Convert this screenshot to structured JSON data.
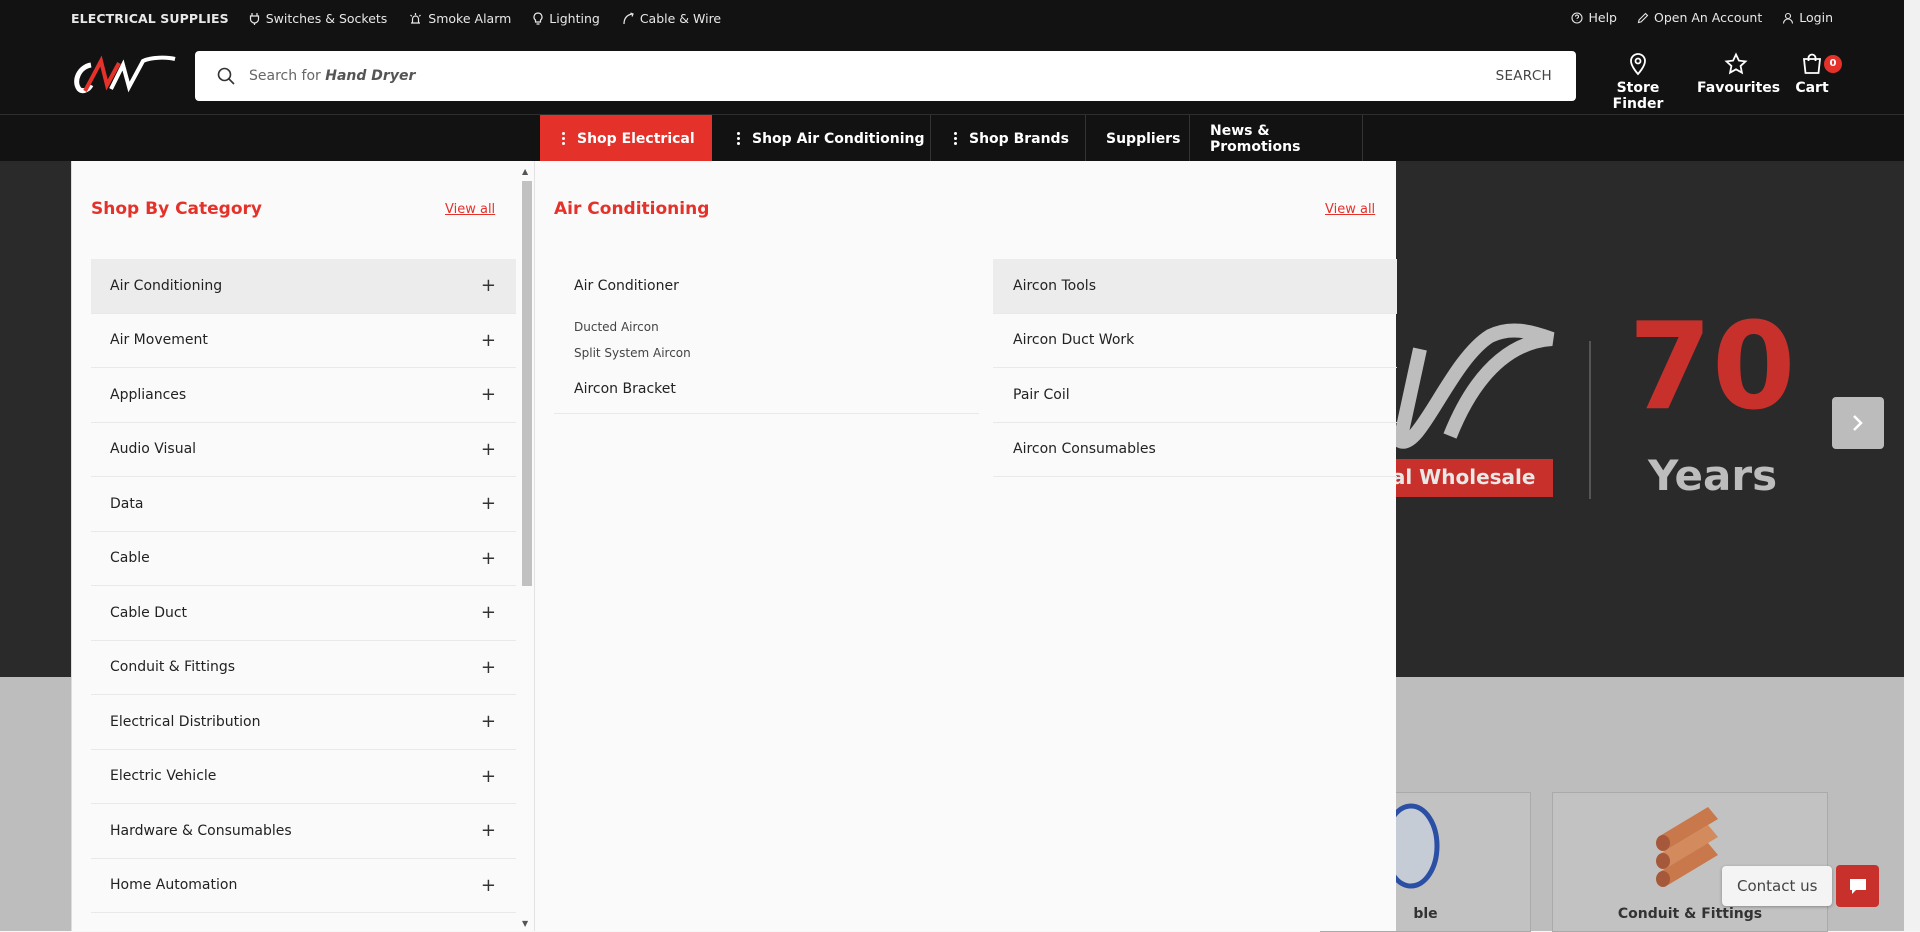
{
  "utility_bar": {
    "brand_text": "ELECTRICAL SUPPLIES",
    "links": [
      {
        "label": "Switches & Sockets",
        "icon": "plug-icon"
      },
      {
        "label": "Smoke Alarm",
        "icon": "alarm-icon"
      },
      {
        "label": "Lighting",
        "icon": "bulb-icon"
      },
      {
        "label": "Cable & Wire",
        "icon": "cable-icon"
      }
    ],
    "account_links": [
      {
        "label": "Help",
        "icon": "help-icon"
      },
      {
        "label": "Open An Account",
        "icon": "pencil-icon"
      },
      {
        "label": "Login",
        "icon": "user-icon"
      }
    ]
  },
  "search": {
    "placeholder_prefix": "Search for",
    "placeholder_term": "Hand Dryer",
    "button_label": "SEARCH"
  },
  "header_actions": {
    "store_finder": "Store Finder",
    "favourites": "Favourites",
    "cart": "Cart",
    "cart_count": "0"
  },
  "main_nav": [
    {
      "label": "Shop Electrical",
      "active": true,
      "has_dots": true
    },
    {
      "label": "Shop Air Conditioning",
      "active": false,
      "has_dots": true
    },
    {
      "label": "Shop Brands",
      "active": false,
      "has_dots": true
    },
    {
      "label": "Suppliers",
      "active": false,
      "has_dots": false
    },
    {
      "label": "News & Promotions",
      "active": false,
      "has_dots": false
    }
  ],
  "mega_menu": {
    "category_title": "Shop By Category",
    "category_view_all": "View all",
    "categories": [
      "Air Conditioning",
      "Air Movement",
      "Appliances",
      "Audio Visual",
      "Data",
      "Cable",
      "Cable Duct",
      "Conduit & Fittings",
      "Electrical Distribution",
      "Electric Vehicle",
      "Hardware & Consumables",
      "Home Automation"
    ],
    "active_category": "Air Conditioning",
    "sub_title": "Air Conditioning",
    "sub_view_all": "View all",
    "sub_left": {
      "air_conditioner": "Air Conditioner",
      "children": [
        "Ducted Aircon",
        "Split System Aircon"
      ],
      "aircon_bracket": "Aircon Bracket"
    },
    "sub_right": [
      "Aircon Tools",
      "Aircon Duct Work",
      "Pair Coil",
      "Aircon Consumables"
    ]
  },
  "hero": {
    "banner_text_1": "cal Wholesale",
    "banner_text_2": "Years",
    "banner_number": "70"
  },
  "cards": {
    "card_1": "ble",
    "card_2": "Conduit & Fittings"
  },
  "contact": {
    "label": "Contact us"
  },
  "colors": {
    "brand_red": "#e4322b",
    "header_bg": "#121212"
  }
}
